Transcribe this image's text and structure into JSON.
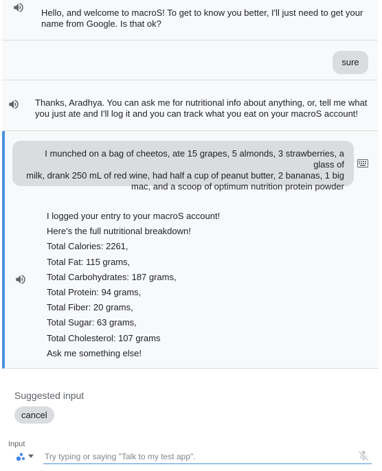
{
  "conversation": {
    "cut_text": "Hello, and welcome to macroS! To get to know you better, I'll just need to get your",
    "welcome_line1": "Hello, and welcome to macroS! To get to know you better, I'll just need to get your",
    "welcome_line2": "name from Google. Is that ok?",
    "user_reply_1": "sure",
    "agent_reply_line1": "Thanks, Aradhya. You can ask me for nutritional info about anything, or, tell me what",
    "agent_reply_line2": "you just ate and I'll log it and you can track what you eat on your macroS account!",
    "user_message_line1": "I munched on a bag of cheetos, ate 15 grapes, 5 almonds, 3 strawberries, a glass of",
    "user_message_line2": "milk, drank 250 mL of red wine, had half a cup of peanut butter, 2 bananas, 1 big",
    "user_message_line3": "mac, and a scoop of optimum nutrition protein powder",
    "breakdown": [
      "I logged your entry to your macroS account!",
      "Here's the full nutritional breakdown!",
      "Total Calories: 2261,",
      "Total Fat: 115 grams,",
      "Total Carbohydrates: 187 grams,",
      "Total Protein: 94 grams,",
      "Total Fiber: 20 grams,",
      "Total Sugar: 63 grams,",
      "Total Cholesterol: 107 grams",
      "Ask me something else!"
    ]
  },
  "suggestions": {
    "label": "Suggested input",
    "chips": [
      "cancel"
    ]
  },
  "input": {
    "label": "Input",
    "placeholder": "Try typing or saying \"Talk to my test app\"."
  },
  "colors": {
    "accent": "#4a90e2",
    "bubble": "#dadce0",
    "pane": "#f8f9fa"
  },
  "icons": {
    "speaker": "volume-icon",
    "keyboard": "keyboard-icon",
    "mic": "mic-off-icon",
    "assistant": "assistant-dots-icon"
  }
}
